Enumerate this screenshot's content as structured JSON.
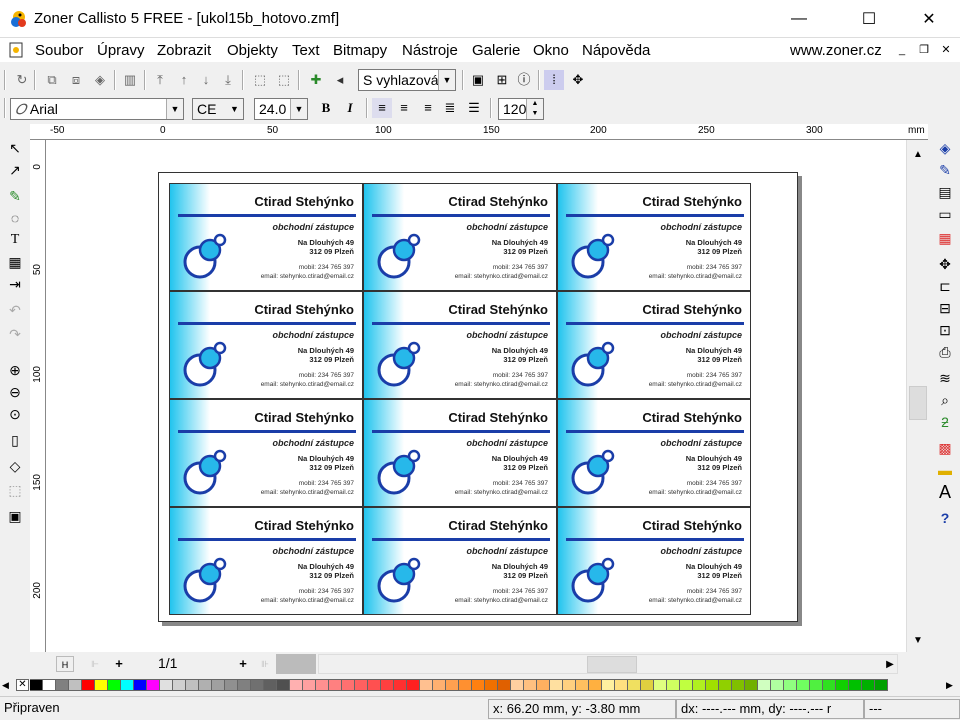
{
  "window": {
    "title": "Zoner Callisto 5 FREE - [ukol15b_hotovo.zmf]",
    "min": "—",
    "max": "☐",
    "close": "✕"
  },
  "menu": {
    "items": [
      "Soubor",
      "Úpravy",
      "Zobrazit",
      "Objekty",
      "Text",
      "Bitmapy",
      "Nástroje",
      "Galerie",
      "Okno",
      "Nápověda"
    ],
    "site": "www.zoner.cz"
  },
  "toolbar": {
    "search_mode": "S vyhlazová",
    "font": "Arial",
    "charset": "CE",
    "size": "24.0",
    "bold": "B",
    "italic": "I",
    "spacing": "120'"
  },
  "ruler": {
    "h_labels": [
      "-50",
      "0",
      "50",
      "100",
      "150",
      "200",
      "250",
      "300"
    ],
    "unit": "mm",
    "v_labels": [
      "0",
      "50",
      "100",
      "150",
      "200"
    ]
  },
  "page_nav": {
    "indicator": "1/1",
    "first": "H",
    "plus": "+"
  },
  "status": {
    "state": "Připraven",
    "coords": "x: 66.20 mm, y: -3.80 mm",
    "delta": "dx: ----.--- mm, dy: ----.--- r",
    "extra": "---"
  },
  "card": {
    "name": "Ctirad Stehýnko",
    "position": "obchodní zástupce",
    "street": "Na Dlouhých 49",
    "city": "312 09 Plzeň",
    "mobile": "mobil: 234 765 397",
    "email": "email: stehynko.ctirad@email.cz"
  },
  "colors": {
    "card_gradient": "#21c4ee",
    "card_bar": "#1a3da8",
    "logo_fill": "#27b8ea",
    "logo_stroke": "#1a3da8"
  },
  "palette": [
    "#000000",
    "#ffffff",
    "#808080",
    "#c0c0c0",
    "#ff0000",
    "#ffff00",
    "#00ff00",
    "#00ffff",
    "#0000ff",
    "#ff00ff",
    "#e0e0e0",
    "#d0d0d0",
    "#c0c0c0",
    "#b0b0b0",
    "#a0a0a0",
    "#909090",
    "#808080",
    "#707070",
    "#606060",
    "#505050",
    "#ffb0b0",
    "#ffa0a0",
    "#ff9090",
    "#ff8080",
    "#ff7070",
    "#ff6060",
    "#ff5050",
    "#ff4040",
    "#ff3030",
    "#ff2020",
    "#ffc090",
    "#ffb070",
    "#ffa050",
    "#ff9030",
    "#ff8010",
    "#f07000",
    "#e06000",
    "#ffd0a0",
    "#ffc080",
    "#ffb060",
    "#ffe0a0",
    "#ffd080",
    "#ffc060",
    "#ffb040",
    "#fff0a0",
    "#ffe080",
    "#f0e060",
    "#e0d040",
    "#e0ff80",
    "#d0ff60",
    "#c0ff40",
    "#b0f020",
    "#a0e000",
    "#90d000",
    "#80c000",
    "#70b000",
    "#d0ffc0",
    "#b0ffa0",
    "#90ff80",
    "#70ff60",
    "#50f040",
    "#30e020",
    "#10d000",
    "#00c000",
    "#00b000",
    "#00a000"
  ]
}
